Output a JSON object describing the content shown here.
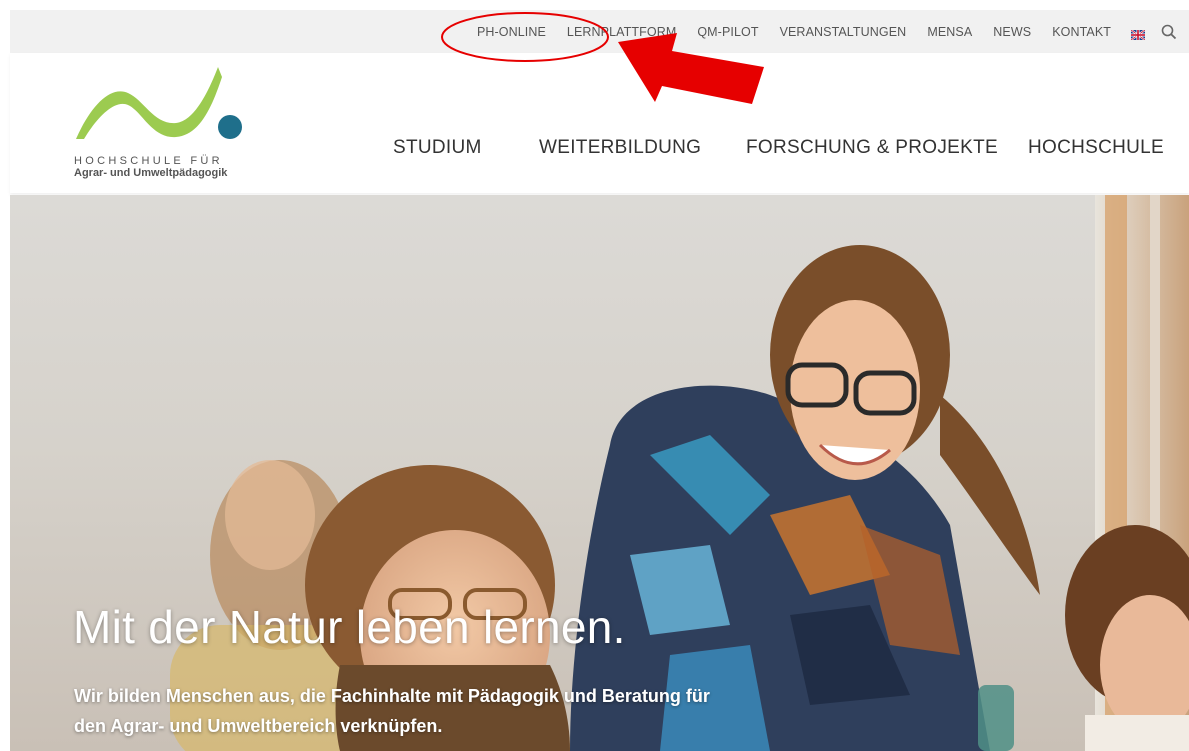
{
  "topbar": {
    "links": [
      "PH-ONLINE",
      "LERNPLATTFORM",
      "QM-PILOT",
      "VERANSTALTUNGEN",
      "MENSA",
      "NEWS",
      "KONTAKT"
    ]
  },
  "logo": {
    "line1": "HOCHSCHULE FÜR",
    "line2": "Agrar- und Umweltpädagogik"
  },
  "mainnav": {
    "items": [
      "STUDIUM",
      "WEITERBILDUNG",
      "FORSCHUNG & PROJEKTE",
      "HOCHSCHULE"
    ]
  },
  "hero": {
    "title": "Mit der Natur leben lernen.",
    "subtitle": "Wir bilden Menschen aus, die Fachinhalte mit Pädagogik und Beratung für den Agrar- und Umweltbereich verknüpfen."
  },
  "colors": {
    "logo_green": "#9ccb50",
    "logo_blue": "#1f6f8b",
    "annotation_red": "#e60000",
    "topbar_bg": "#f1f1f1"
  },
  "icons": {
    "language": "uk-flag-icon",
    "search": "search-icon"
  }
}
